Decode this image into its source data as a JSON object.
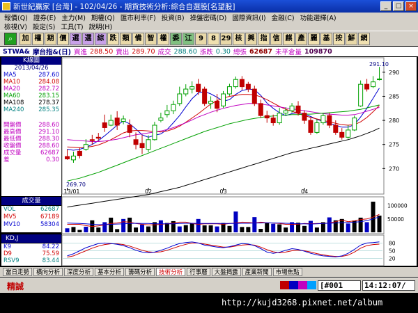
{
  "window": {
    "title": "新世紀贏家 [台灣] - 102/04/26 - 期貨技術分析:綜合自選股[名望股]"
  },
  "menu": {
    "row1": [
      "報價(Q)",
      "證券(E)",
      "主力(M)",
      "期權(Q)",
      "匯市利率(F)",
      "投資(B)",
      "操盤密碼(D)",
      "國際資訊(I)",
      "金融(C)",
      "功能選擇(A)"
    ],
    "row2": [
      "檢視(V)",
      "設定(S)",
      "工具(T)",
      "說明(H)"
    ]
  },
  "toolbar": {
    "buttons": [
      "加",
      "權",
      "期",
      "價",
      "選",
      "選",
      "綜",
      "跌",
      "類",
      "備",
      "智",
      "權",
      "委",
      "江",
      "9",
      "8",
      "29",
      "核",
      "興",
      "指",
      "信",
      "麒",
      "產",
      "麗",
      "基",
      "按",
      "鮮",
      "網"
    ]
  },
  "quote": {
    "symbol": "STWA&",
    "name": "摩台指&(日)",
    "bid_label": "買進",
    "bid": "288.50",
    "ask_label": "賣出",
    "ask": "289.70",
    "last_label": "成交",
    "last": "288.60",
    "change_label": "漲跌",
    "change": "0.30",
    "volume_label": "總張",
    "volume": "62687",
    "oi_label": "未平倉量",
    "oi": "109870"
  },
  "legend": {
    "header": "K線圖",
    "date": "2013/04/26",
    "ma": [
      {
        "name": "MA5",
        "value": "287.60",
        "color": "#0000d0"
      },
      {
        "name": "MA10",
        "value": "284.08",
        "color": "#d00000"
      },
      {
        "name": "MA20",
        "value": "282.72",
        "color": "#c000c0"
      },
      {
        "name": "MA60",
        "value": "283.15",
        "color": "#00a000"
      },
      {
        "name": "MA108",
        "value": "278.37",
        "color": "#000000"
      },
      {
        "name": "MA240",
        "value": "285.35",
        "color": "#008080"
      }
    ],
    "ohlc": [
      {
        "name": "開盤價",
        "value": "288.60"
      },
      {
        "name": "最高價",
        "value": "291.10"
      },
      {
        "name": "最低價",
        "value": "288.30"
      },
      {
        "name": "收盤價",
        "value": "288.60"
      },
      {
        "name": "成交量",
        "value": "62687"
      },
      {
        "name": "差",
        "value": "0.30"
      }
    ]
  },
  "volume_panel": {
    "header": "成交量",
    "rows": [
      {
        "name": "VOL",
        "value": "62687",
        "color": "#008080"
      },
      {
        "name": "MV5",
        "value": "67189",
        "color": "#d00000"
      },
      {
        "name": "MV10",
        "value": "58304",
        "color": "#0000d0"
      }
    ]
  },
  "kd_panel": {
    "header": "KD,J",
    "rows": [
      {
        "name": "K9",
        "value": "84.22",
        "color": "#0000d0"
      },
      {
        "name": "D9",
        "value": "75.59",
        "color": "#d00000"
      },
      {
        "name": "RSV9",
        "value": "83.44",
        "color": "#008080"
      }
    ]
  },
  "chart_data": {
    "type": "candlestick",
    "x_labels": [
      "13/01",
      "02",
      "03",
      "04"
    ],
    "y_ticks": [
      270,
      275,
      280,
      285,
      290
    ],
    "ylim": [
      266,
      292
    ],
    "high_label": "291.10",
    "low_label": "269.70",
    "candles": [
      [
        272.5,
        272.0,
        274.0,
        271.8
      ],
      [
        271.8,
        272.6,
        273.5,
        271.2
      ],
      [
        273.6,
        272.7,
        274.4,
        272.1
      ],
      [
        274.0,
        275.0,
        276.1,
        273.7
      ],
      [
        276.0,
        275.8,
        277.0,
        275.0
      ],
      [
        276.5,
        276.3,
        277.4,
        275.8
      ],
      [
        279.5,
        278.5,
        281.2,
        277.6
      ],
      [
        279.0,
        280.0,
        281.2,
        278.8
      ],
      [
        280.5,
        279.0,
        281.9,
        278.0
      ],
      [
        279.8,
        280.3,
        281.0,
        279.2
      ],
      [
        279.0,
        277.5,
        280.2,
        276.5
      ],
      [
        276.0,
        275.0,
        277.5,
        274.0
      ],
      [
        275.2,
        274.3,
        277.0,
        273.0
      ],
      [
        274.0,
        276.0,
        276.9,
        273.4
      ],
      [
        276.0,
        279.0,
        279.7,
        275.8
      ],
      [
        280.0,
        280.5,
        281.6,
        279.6
      ],
      [
        281.2,
        282.0,
        283.2,
        280.6
      ],
      [
        282.0,
        283.3,
        284.1,
        281.3
      ],
      [
        283.5,
        285.5,
        287.0,
        283.0
      ],
      [
        285.5,
        286.5,
        287.5,
        285.0
      ],
      [
        286.5,
        287.0,
        288.1,
        285.6
      ],
      [
        287.5,
        286.0,
        288.6,
        285.3
      ],
      [
        286.5,
        283.5,
        287.0,
        283.0
      ],
      [
        283.5,
        284.0,
        285.0,
        282.4
      ],
      [
        284.0,
        282.5,
        285.5,
        281.7
      ],
      [
        283.0,
        285.5,
        286.1,
        282.6
      ],
      [
        285.5,
        287.0,
        287.6,
        285.1
      ],
      [
        287.0,
        288.5,
        289.1,
        286.6
      ],
      [
        288.5,
        287.0,
        289.2,
        286.3
      ],
      [
        287.5,
        286.5,
        288.0,
        285.9
      ],
      [
        286.5,
        283.5,
        287.2,
        283.0
      ],
      [
        283.5,
        281.0,
        284.3,
        280.5
      ],
      [
        281.0,
        280.5,
        282.0,
        279.5
      ],
      [
        280.5,
        279.5,
        281.2,
        278.9
      ],
      [
        279.5,
        281.5,
        282.6,
        279.1
      ],
      [
        281.5,
        282.0,
        282.7,
        281.0
      ],
      [
        282.0,
        283.0,
        283.6,
        281.6
      ],
      [
        283.0,
        281.5,
        284.0,
        281.0
      ],
      [
        281.5,
        280.0,
        282.1,
        279.3
      ],
      [
        280.0,
        277.5,
        280.5,
        277.0
      ],
      [
        277.5,
        279.5,
        280.2,
        277.2
      ],
      [
        279.5,
        281.0,
        281.5,
        279.1
      ],
      [
        281.0,
        279.0,
        281.6,
        278.4
      ],
      [
        279.0,
        277.5,
        280.0,
        277.0
      ],
      [
        277.5,
        276.5,
        278.4,
        276.0
      ],
      [
        276.5,
        278.0,
        279.0,
        276.2
      ],
      [
        278.0,
        280.5,
        281.0,
        277.8
      ],
      [
        283.0,
        287.5,
        288.3,
        282.8
      ],
      [
        287.5,
        286.5,
        288.6,
        286.0
      ],
      [
        287.0,
        288.0,
        289.2,
        286.7
      ],
      [
        288.6,
        288.6,
        291.1,
        288.3
      ]
    ],
    "ma_series": [
      {
        "name": "MA5",
        "color": "#0000d0",
        "values": [
          274.0,
          273.8,
          274.0,
          274.4,
          275.0,
          275.8,
          276.8,
          277.9,
          279.0,
          279.9,
          279.3,
          278.2,
          277.0,
          276.5,
          276.9,
          277.2,
          278.1,
          279.5,
          281.0,
          282.8,
          284.5,
          285.7,
          286.0,
          285.5,
          284.8,
          284.0,
          284.3,
          285.4,
          286.2,
          286.5,
          286.4,
          285.2,
          283.6,
          282.5,
          281.6,
          281.0,
          281.4,
          281.6,
          281.3,
          280.8,
          280.2,
          279.8,
          279.4,
          279.0,
          278.6,
          278.6,
          279.1,
          280.7,
          282.5,
          284.6,
          286.7
        ]
      },
      {
        "name": "MA10",
        "color": "#d00000",
        "values": [
          274.5,
          274.4,
          274.3,
          274.4,
          274.6,
          274.9,
          275.4,
          276.0,
          276.7,
          277.4,
          277.8,
          277.9,
          277.9,
          277.8,
          277.7,
          277.6,
          277.8,
          278.2,
          278.8,
          279.6,
          280.5,
          281.4,
          282.4,
          283.4,
          284.1,
          284.6,
          285.0,
          285.2,
          285.4,
          285.4,
          285.3,
          284.9,
          284.3,
          283.6,
          282.9,
          282.3,
          281.9,
          281.4,
          281.0,
          280.6,
          280.3,
          280.0,
          279.7,
          279.4,
          279.1,
          279.0,
          279.1,
          279.7,
          280.6,
          281.8,
          283.1
        ]
      },
      {
        "name": "MA20",
        "color": "#c000c0",
        "values": [
          276.0,
          275.9,
          275.8,
          275.7,
          275.6,
          275.6,
          275.7,
          275.9,
          276.1,
          276.4,
          276.7,
          277.0,
          277.2,
          277.4,
          277.6,
          277.8,
          278.1,
          278.5,
          279.0,
          279.5,
          280.1,
          280.7,
          281.2,
          281.7,
          282.1,
          282.5,
          282.8,
          283.1,
          283.3,
          283.5,
          283.5,
          283.4,
          283.2,
          283.0,
          282.8,
          282.6,
          282.4,
          282.2,
          282.0,
          281.8,
          281.6,
          281.4,
          281.3,
          281.2,
          281.1,
          281.1,
          281.2,
          281.5,
          281.9,
          282.3,
          282.7
        ]
      },
      {
        "name": "MA60",
        "color": "#00a000",
        "values": [
          267.4,
          267.7,
          268.0,
          268.4,
          268.8,
          269.2,
          269.7,
          270.2,
          270.7,
          271.2,
          271.7,
          272.2,
          272.7,
          273.2,
          273.7,
          274.2,
          274.7,
          275.2,
          275.7,
          276.2,
          276.7,
          277.2,
          277.7,
          278.1,
          278.5,
          278.9,
          279.3,
          279.6,
          279.9,
          280.2,
          280.4,
          280.6,
          280.8,
          280.9,
          281.0,
          281.1,
          281.2,
          281.2,
          281.3,
          281.3,
          281.4,
          281.5,
          281.6,
          281.7,
          281.8,
          281.9,
          282.1,
          282.3,
          282.6,
          282.9,
          283.2
        ]
      },
      {
        "name": "MA108",
        "color": "#000000",
        "values": [
          262.0,
          262.2,
          262.4,
          262.6,
          262.8,
          263.0,
          263.2,
          263.4,
          263.6,
          263.8,
          264.0,
          264.2,
          264.4,
          264.6,
          264.9,
          265.2,
          265.5,
          265.8,
          266.1,
          266.5,
          266.9,
          267.3,
          267.7,
          268.1,
          268.5,
          268.9,
          269.3,
          269.7,
          270.1,
          270.5,
          270.9,
          271.3,
          271.7,
          272.1,
          272.5,
          272.9,
          273.3,
          273.6,
          273.9,
          274.2,
          274.5,
          274.8,
          275.1,
          275.4,
          275.7,
          276.0,
          276.4,
          276.8,
          277.3,
          277.8,
          278.4
        ]
      }
    ],
    "volume": [
      15000,
      20000,
      9000,
      21000,
      45000,
      18000,
      38000,
      55000,
      12000,
      50000,
      55000,
      18000,
      29000,
      22000,
      38000,
      45000,
      35000,
      42000,
      22000,
      27000,
      33000,
      50000,
      26000,
      26000,
      22000,
      35000,
      24000,
      78000,
      20000,
      20000,
      57000,
      13000,
      34000,
      32000,
      30000,
      18000,
      38000,
      36000,
      24000,
      43000,
      18000,
      38000,
      56000,
      45000,
      50000,
      33000,
      44000,
      55000,
      38000,
      115000,
      62687
    ],
    "mv5": [
      30000,
      30000,
      30000,
      25000,
      22000,
      24000,
      28000,
      33000,
      35000,
      40000,
      38000,
      33000,
      30000,
      28000,
      28000,
      30000,
      32000,
      35000,
      38000,
      38000,
      33000,
      30000,
      32000,
      32000,
      32000,
      30000,
      33000,
      35000,
      38000,
      37000,
      35000,
      38000,
      36000,
      35000,
      33000,
      30000,
      30000,
      30000,
      33000,
      32000,
      33000,
      33000,
      35000,
      40000,
      46000,
      40000,
      43000,
      48000,
      50000,
      57000,
      67189
    ],
    "mv10": [
      35000,
      34000,
      33000,
      32000,
      30000,
      29000,
      29000,
      30000,
      31000,
      32000,
      33000,
      34000,
      33000,
      33000,
      32000,
      32000,
      32000,
      32000,
      33000,
      34000,
      34000,
      33000,
      33000,
      33000,
      33000,
      33000,
      33000,
      33000,
      34000,
      34000,
      35000,
      35000,
      36000,
      35000,
      35000,
      34000,
      33000,
      32000,
      32000,
      31000,
      32000,
      33000,
      34000,
      35000,
      36000,
      37000,
      38000,
      40000,
      44000,
      50000,
      58304
    ],
    "volume_ticks": [
      100000,
      50000
    ],
    "kd": {
      "k": [
        30,
        38,
        50,
        62,
        70,
        78,
        80,
        78,
        75,
        70,
        62,
        52,
        45,
        42,
        45,
        52,
        60,
        70,
        78,
        82,
        84,
        80,
        72,
        68,
        64,
        62,
        66,
        72,
        78,
        76,
        70,
        58,
        45,
        40,
        44,
        52,
        58,
        55,
        48,
        40,
        34,
        30,
        28,
        26,
        30,
        40,
        55,
        72,
        80,
        82,
        84.22
      ],
      "d": [
        25,
        30,
        40,
        50,
        60,
        68,
        74,
        77,
        77,
        74,
        68,
        60,
        52,
        46,
        44,
        46,
        52,
        60,
        68,
        75,
        80,
        80,
        76,
        72,
        68,
        64,
        64,
        68,
        72,
        74,
        72,
        64,
        54,
        46,
        42,
        45,
        50,
        52,
        50,
        45,
        39,
        34,
        30,
        28,
        28,
        33,
        45,
        60,
        70,
        74,
        75.59
      ],
      "rsv": [
        40,
        50,
        65,
        75,
        82,
        85,
        80,
        75,
        68,
        60,
        48,
        38,
        35,
        40,
        52,
        65,
        78,
        85,
        88,
        86,
        78,
        68,
        60,
        62,
        60,
        70,
        80,
        85,
        78,
        70,
        55,
        35,
        30,
        38,
        55,
        65,
        60,
        48,
        35,
        28,
        25,
        20,
        22,
        30,
        55,
        75,
        90,
        88,
        82,
        80,
        83.44
      ],
      "ticks": [
        20,
        50,
        80
      ]
    }
  },
  "tabs": [
    "當日走勢",
    "橫向分析",
    "深度分析",
    "基本分析",
    "籌碼分析",
    "技術分析",
    "行事曆",
    "大盤揭露",
    "產業新聞",
    "市場焦點"
  ],
  "active_tab": "技術分析",
  "status": {
    "tag": "精誠",
    "record": "[#001",
    "clock": "14:12:07/",
    "colors": [
      "#c00000",
      "#0000c0",
      "#c000c0",
      "#00a0ff"
    ]
  },
  "watermark": "http://kujd3268.pixnet.net/album"
}
